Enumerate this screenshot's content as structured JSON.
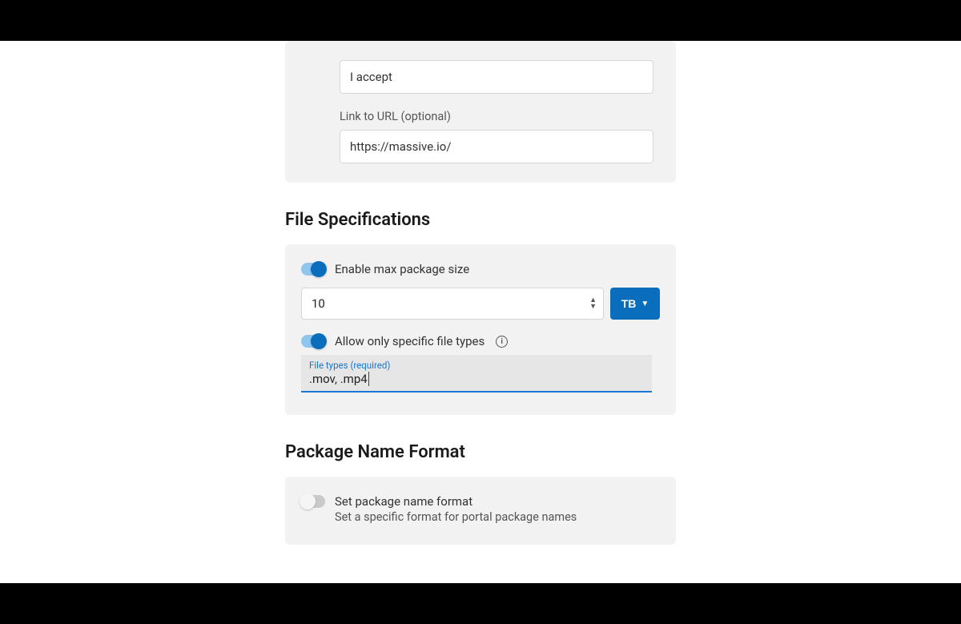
{
  "topPanel": {
    "accept_value": "I accept",
    "link_label": "Link to URL (optional)",
    "link_value": "https://massive.io/"
  },
  "fileSpecs": {
    "title": "File Specifications",
    "toggle_max_label": "Enable max package size",
    "max_size_value": "10",
    "unit_label": "TB",
    "toggle_types_label": "Allow only specific file types",
    "file_types_floating_label": "File types (required)",
    "file_types_value": ".mov, .mp4"
  },
  "packageName": {
    "title": "Package Name Format",
    "toggle_label": "Set package name format",
    "desc": "Set a specific format for portal package names"
  }
}
